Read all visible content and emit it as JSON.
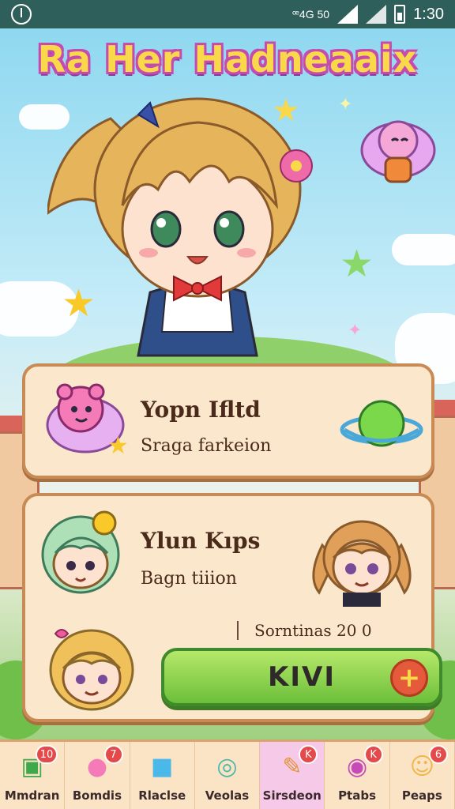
{
  "status_bar": {
    "small_text": "ꟹ4G 50",
    "time": "1:30"
  },
  "game": {
    "title": "Ra Her Hadneaaix"
  },
  "card1": {
    "title": "Yopn Ifltd",
    "subtitle": "Sraga farkeion"
  },
  "card2": {
    "title": "Ylun Kıps",
    "subtitle": "Bagn tiiion",
    "meta": "Sorntinas 20 0",
    "action_label": "KIVI",
    "plus_label": "+"
  },
  "tabs": [
    {
      "label": "Mmdran",
      "badge": "10",
      "icon": "table-icon"
    },
    {
      "label": "Bomdis",
      "badge": "7",
      "icon": "speech-bubble-icon"
    },
    {
      "label": "Rlaclse",
      "badge": "",
      "icon": "robot-cup-icon"
    },
    {
      "label": "Veolas",
      "badge": "",
      "icon": "magnifier-icon"
    },
    {
      "label": "Sirsdeon",
      "badge": "K",
      "icon": "brush-icon",
      "active": true
    },
    {
      "label": "Ptabs",
      "badge": "K",
      "icon": "planet-icon"
    },
    {
      "label": "Peaps",
      "badge": "6",
      "icon": "cat-face-icon"
    }
  ],
  "colors": {
    "accent": "#6cbf3a",
    "card_bg": "#fbe8cc",
    "card_border": "#c98b56",
    "title_fill": "#f9d84a",
    "title_stroke": "#c44bb0",
    "badge": "#e54a4a"
  }
}
